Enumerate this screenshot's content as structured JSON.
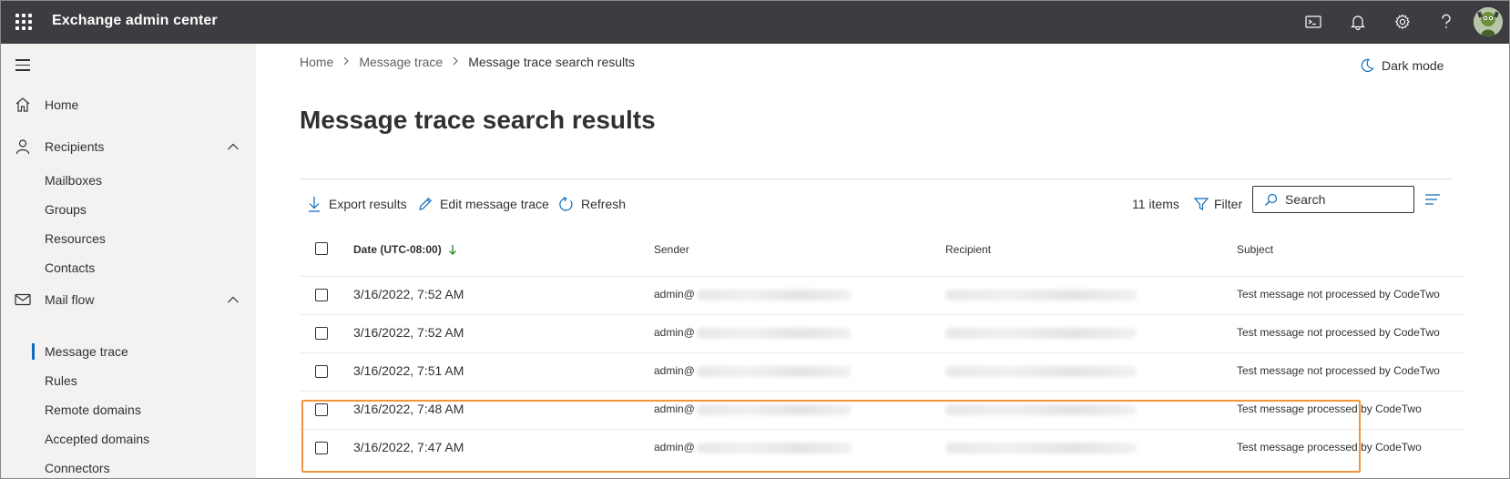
{
  "app": {
    "title": "Exchange admin center"
  },
  "topbar": {
    "icons": [
      "terminal-icon",
      "bell-icon",
      "gear-icon",
      "help-icon"
    ]
  },
  "sidebar": {
    "items": [
      {
        "label": "Home",
        "icon": "home-icon"
      },
      {
        "label": "Recipients",
        "icon": "person-icon",
        "expanded": true,
        "children": [
          "Mailboxes",
          "Groups",
          "Resources",
          "Contacts"
        ]
      },
      {
        "label": "Mail flow",
        "icon": "mail-icon",
        "expanded": true,
        "children": [
          "Message trace",
          "Rules",
          "Remote domains",
          "Accepted domains",
          "Connectors"
        ]
      }
    ],
    "active": "Message trace"
  },
  "breadcrumb": {
    "items": [
      "Home",
      "Message trace",
      "Message trace search results"
    ]
  },
  "dark_mode_label": "Dark mode",
  "page_title": "Message trace search results",
  "commands": {
    "export": "Export results",
    "edit": "Edit message trace",
    "refresh": "Refresh",
    "items_count": "11 items",
    "filter": "Filter",
    "search_placeholder": "Search"
  },
  "table": {
    "columns": [
      "Date (UTC-08:00)",
      "Sender",
      "Recipient",
      "Subject"
    ],
    "rows": [
      {
        "date": "3/16/2022, 7:52 AM",
        "sender": "admin@",
        "subject": "Test message not processed by CodeTwo"
      },
      {
        "date": "3/16/2022, 7:52 AM",
        "sender": "admin@",
        "subject": "Test message not processed by CodeTwo"
      },
      {
        "date": "3/16/2022, 7:51 AM",
        "sender": "admin@",
        "subject": "Test message not processed by CodeTwo"
      },
      {
        "date": "3/16/2022, 7:48 AM",
        "sender": "admin@",
        "subject": "Test message processed by CodeTwo"
      },
      {
        "date": "3/16/2022, 7:47 AM",
        "sender": "admin@",
        "subject": "Test message processed by CodeTwo"
      }
    ]
  },
  "colors": {
    "accent": "#0f6cbd",
    "topbar": "#3c3c41",
    "sidebar": "#f3f2f1",
    "highlight": "#f0953a"
  }
}
